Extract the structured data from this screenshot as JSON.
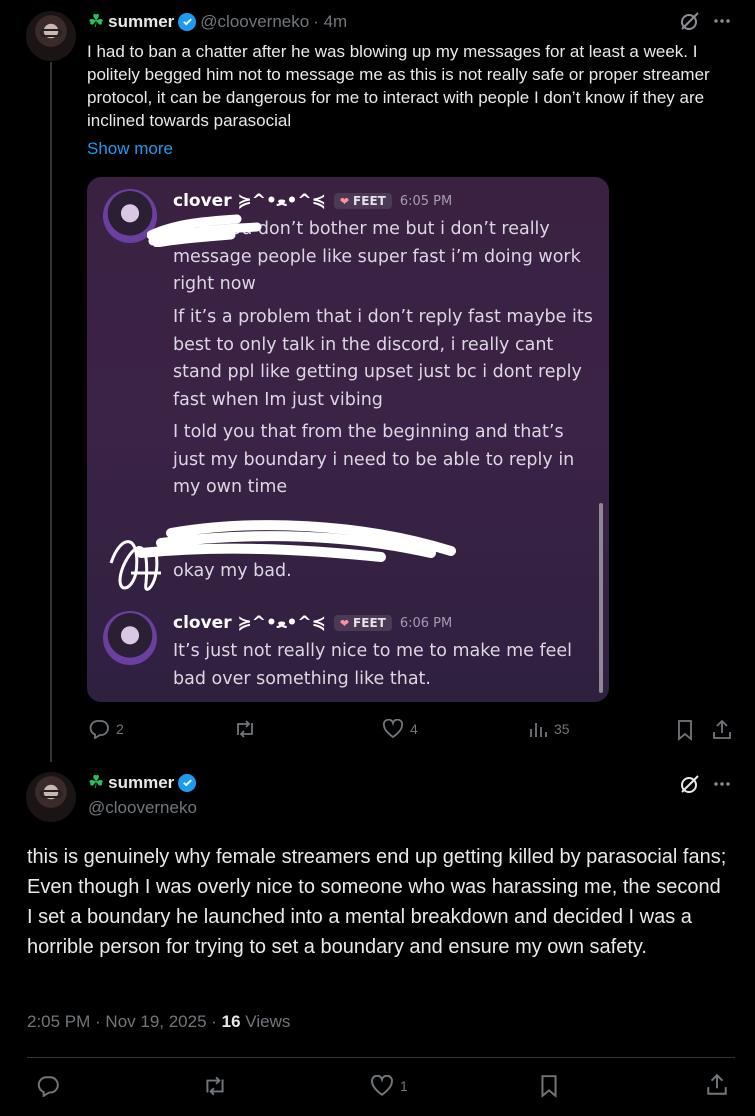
{
  "tweet1": {
    "display_name": "summer",
    "clover": "☘",
    "handle": "@clooverneko",
    "time": "· 4m",
    "text": "I had to ban a chatter after he was blowing up my messages for at least a week. I politely begged him not to message me as this is not really safe or proper streamer protocol, it can be dangerous for me to interact with people I don’t know if they are inclined towards parasocial",
    "show_more": "Show more",
    "actions": {
      "replies": "2",
      "reposts": "",
      "likes": "4",
      "views": "35"
    }
  },
  "discord": {
    "msg1": {
      "name": "clover ≽^•ﻌ•^≼",
      "tag": "FEET",
      "time": "6:05 PM",
      "lines": [
        "okay you don’t bother me but i don’t really message people like super fast i’m doing work right now",
        "If it’s a problem that i don’t reply fast maybe its best to only talk in the discord, i really cant stand ppl like getting upset just bc i dont reply fast when Im just vibing",
        "I told you that from the beginning and that’s just my boundary i need to be able to reply in my own time"
      ]
    },
    "msg2": {
      "text": "okay my bad."
    },
    "msg3": {
      "name": "clover ≽^•ﻌ•^≼",
      "tag": "FEET",
      "time": "6:06 PM",
      "text": "It’s just not really nice to me to make me feel bad over something like that."
    }
  },
  "tweet2": {
    "display_name": "summer",
    "clover": "☘",
    "handle": "@clooverneko",
    "text": "this is genuinely why female streamers end up getting killed by parasocial fans; Even though I was overly nice to someone who was harassing me, the second I set a boundary he launched into a mental breakdown and decided I was a horrible person for trying to set a boundary and ensure my own safety.",
    "timestamp": "2:05 PM · Nov 19, 2025 · ",
    "views_count": "16",
    "views_label": " Views",
    "actions": {
      "likes": "1"
    }
  },
  "colors": {
    "accent": "#1d9bf0",
    "clover": "#2dbe60",
    "muted": "#71767b"
  }
}
